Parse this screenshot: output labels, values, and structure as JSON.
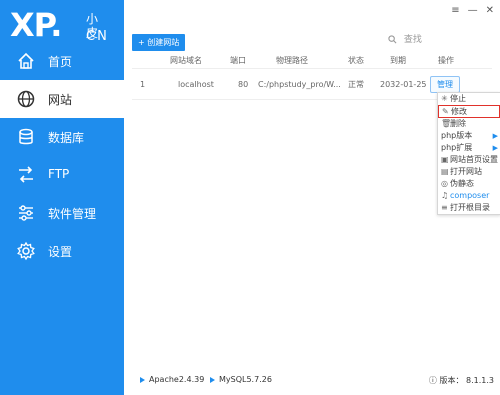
{
  "app": {
    "logo_main": "XP.",
    "logo_cn_top": "小皮",
    "logo_cn_bottom": "CN"
  },
  "sidebar": {
    "items": [
      {
        "label": "首页",
        "icon": "home-icon"
      },
      {
        "label": "网站",
        "icon": "globe-icon"
      },
      {
        "label": "数据库",
        "icon": "database-icon"
      },
      {
        "label": "FTP",
        "icon": "ftp-icon"
      },
      {
        "label": "软件管理",
        "icon": "sliders-icon"
      },
      {
        "label": "设置",
        "icon": "gear-icon"
      }
    ],
    "active_index": 1
  },
  "window_controls": {
    "menu": "≡",
    "minimize": "—",
    "close": "✕"
  },
  "toolbar": {
    "create_label": "+ 创建网站"
  },
  "search": {
    "placeholder": "查找"
  },
  "table": {
    "headers": [
      "网站域名",
      "端口",
      "物理路径",
      "状态",
      "到期",
      "操作"
    ],
    "rows": [
      {
        "index": "1",
        "domain": "localhost",
        "port": "80",
        "path": "C:/phpstudy_pro/W...",
        "status": "正常",
        "expire": "2032-01-25",
        "action": "管理"
      }
    ]
  },
  "context_menu": {
    "items": [
      {
        "label": "停止",
        "icon": "stop-icon",
        "submenu": false
      },
      {
        "label": "修改",
        "icon": "edit-icon",
        "submenu": false,
        "selected": true
      },
      {
        "label": "删除",
        "icon": "trash-icon",
        "submenu": false
      },
      {
        "label": "php版本",
        "icon": "",
        "submenu": true
      },
      {
        "label": "php扩展",
        "icon": "",
        "submenu": true
      },
      {
        "label": "网站首页设置",
        "icon": "home-settings-icon",
        "submenu": false
      },
      {
        "label": "打开网站",
        "icon": "open-site-icon",
        "submenu": false
      },
      {
        "label": "伪静态",
        "icon": "rewrite-icon",
        "submenu": false
      },
      {
        "label": "composer",
        "icon": "composer-icon",
        "submenu": false
      },
      {
        "label": "打开根目录",
        "icon": "folder-icon",
        "submenu": false
      }
    ]
  },
  "footer": {
    "services": [
      {
        "name": "Apache2.4.39"
      },
      {
        "name": "MySQL5.7.26"
      }
    ],
    "version": "版本： 8.1.1.3"
  },
  "colors": {
    "accent": "#1f8ded",
    "highlight_border": "#e0322b"
  }
}
